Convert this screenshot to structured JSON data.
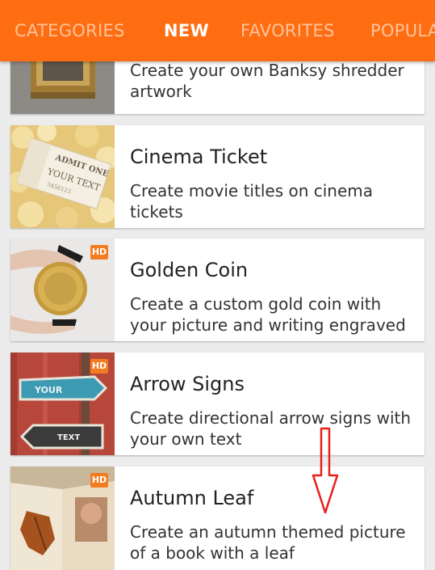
{
  "tabs": [
    {
      "label": "CATEGORIES",
      "active": false
    },
    {
      "label": "NEW",
      "active": true
    },
    {
      "label": "FAVORITES",
      "active": false
    },
    {
      "label": "POPULA",
      "active": false
    }
  ],
  "items": [
    {
      "title": "",
      "description": "Create your own Banksy shredder artwork",
      "hd": false
    },
    {
      "title": "Cinema Ticket",
      "description": "Create movie titles on cinema tickets",
      "hd": false,
      "thumb_text": {
        "line1": "ADMIT ONE",
        "line2": "YOUR TEXT",
        "line3": "3456123"
      }
    },
    {
      "title": "Golden Coin",
      "description": "Create a custom gold coin with your picture and writing engraved",
      "hd": true,
      "badge": "HD"
    },
    {
      "title": "Arrow Signs",
      "description": "Create directional arrow signs with your own text",
      "hd": true,
      "badge": "HD",
      "thumb_text": {
        "sign1": "YOUR",
        "sign2": "TEXT"
      }
    },
    {
      "title": "Autumn Leaf",
      "description": "Create an autumn themed picture of a book with a leaf",
      "hd": true,
      "badge": "HD"
    }
  ],
  "colors": {
    "topbar": "#ff6d12",
    "active_tab": "#ffffff",
    "inactive_tab": "#ffc39a",
    "annotation_arrow": "#e8201a"
  }
}
